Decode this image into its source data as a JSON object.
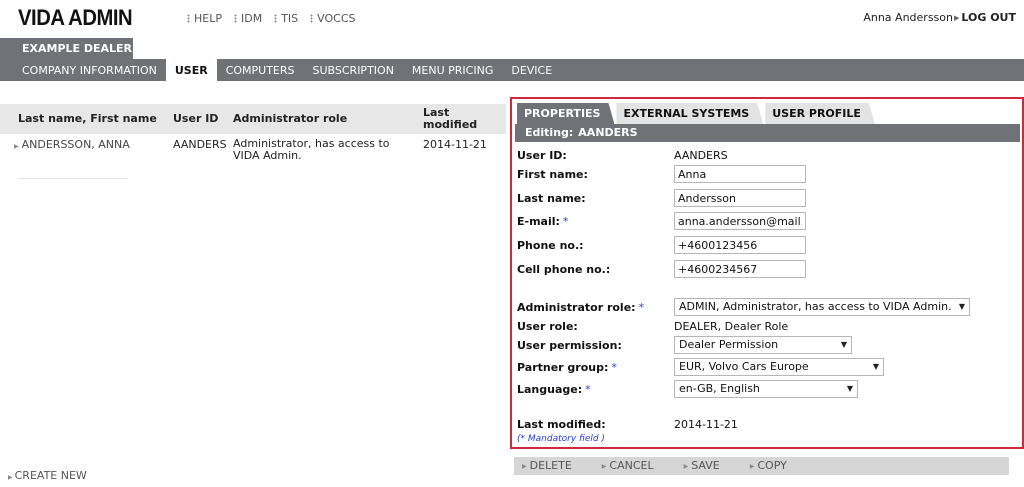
{
  "header": {
    "logo": "VIDA ADMIN",
    "links": [
      "HELP",
      "IDM",
      "TIS",
      "VOCCS"
    ],
    "user_name": "Anna Andersson",
    "logout": "LOG OUT"
  },
  "dealer_tab": "EXAMPLE DEALER",
  "nav": {
    "items": [
      "COMPANY INFORMATION",
      "USER",
      "COMPUTERS",
      "SUBSCRIPTION",
      "MENU PRICING",
      "DEVICE"
    ],
    "active": "USER"
  },
  "users_table": {
    "columns": [
      "Last name, First name",
      "User ID",
      "Administrator role",
      "Last modified"
    ],
    "rows": [
      {
        "name": "ANDERSSON, ANNA",
        "user_id": "AANDERS",
        "role": "Administrator, has access to VIDA Admin.",
        "last_modified": "2014-11-21"
      }
    ]
  },
  "create_new": "CREATE NEW",
  "panel": {
    "tabs": [
      "PROPERTIES",
      "EXTERNAL SYSTEMS",
      "USER PROFILE"
    ],
    "active_tab": "PROPERTIES",
    "editing_label": "Editing:",
    "editing_user": "AANDERS",
    "labels": {
      "user_id": "User ID:",
      "first_name": "First name:",
      "last_name": "Last name:",
      "email": "E-mail:",
      "phone": "Phone no.:",
      "cell_phone": "Cell phone no.:",
      "admin_role": "Administrator role:",
      "user_role": "User role:",
      "user_permission": "User permission:",
      "partner_group": "Partner group:",
      "language": "Language:",
      "last_modified": "Last modified:"
    },
    "required_star": "*",
    "values": {
      "user_id": "AANDERS",
      "first_name": "Anna",
      "last_name": "Andersson",
      "email": "anna.andersson@mail.com",
      "phone": "+4600123456",
      "cell_phone": "+4600234567",
      "admin_role": "ADMIN, Administrator, has access to VIDA Admin.",
      "user_role": "DEALER, Dealer Role",
      "user_permission": "Dealer Permission",
      "partner_group": "EUR, Volvo Cars Europe",
      "language": "en-GB, English",
      "last_modified": "2014-11-21"
    },
    "mandatory_note": "(* Mandatory field )"
  },
  "actions": [
    "DELETE",
    "CANCEL",
    "SAVE",
    "COPY"
  ],
  "colors": {
    "nav_bg": "#6f7277",
    "highlight_border": "#d0283c",
    "required": "#2a3fd0"
  }
}
